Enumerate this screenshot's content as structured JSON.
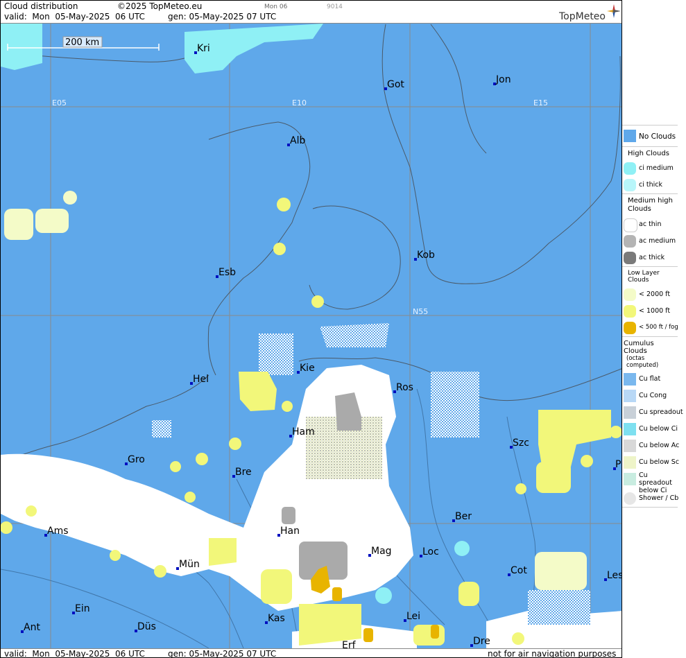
{
  "header": {
    "title": "Cloud distribution",
    "copyright": "©2025 TopMeteo.eu",
    "day_code": "Mon 06",
    "code": "9014",
    "valid": "valid:  Mon  05-May-2025  06 UTC",
    "gen": "gen: 05-May-2025 07 UTC",
    "brand": "TopMeteo"
  },
  "footer": {
    "valid": "valid:  Mon  05-May-2025  06 UTC",
    "gen": "gen: 05-May-2025 07 UTC",
    "disclaimer": "not for air navigation purposes"
  },
  "map": {
    "scale_label": "200 km",
    "grid_labels": {
      "e05": "E05",
      "e10": "E10",
      "e15": "E15",
      "n55": "N55"
    },
    "cities": {
      "kri": "Kri",
      "got": "Got",
      "jon": "Jon",
      "alb": "Alb",
      "kob": "Kob",
      "esb": "Esb",
      "kie": "Kie",
      "hel": "Hel",
      "ros": "Ros",
      "ham": "Ham",
      "szc": "Szc",
      "gro": "Gro",
      "bre": "Bre",
      "ber": "Ber",
      "ams": "Ams",
      "han": "Han",
      "mag": "Mag",
      "loc": "Loc",
      "mun": "Mün",
      "cot": "Cot",
      "les": "Les",
      "ein": "Ein",
      "kas": "Kas",
      "lei": "Lei",
      "ant": "Ant",
      "dus": "Düs",
      "dre": "Dre",
      "erf": "Erf",
      "p": "P"
    }
  },
  "legend": {
    "no_clouds": "No Clouds",
    "high_clouds": "High Clouds",
    "ci_medium": "ci medium",
    "ci_thick": "ci thick",
    "medium_high": "Medium high Clouds",
    "ac_thin": "ac thin",
    "ac_medium": "ac medium",
    "ac_thick": "ac thick",
    "low_layer": "Low Layer Clouds",
    "lt2000": "< 2000 ft",
    "lt1000": "< 1000 ft",
    "lt500": "< 500 ft / fog",
    "cumulus": "Cumulus Clouds",
    "cumulus_sub": "(octas computed)",
    "cu_flat": "Cu flat",
    "cu_cong": "Cu Cong",
    "cu_spreadout": "Cu spreadout",
    "cu_below_ci": "Cu below Ci",
    "cu_below_ac": "Cu below Ac",
    "cu_below_sc": "Cu below Sc",
    "cu_spreadout_below_ci": "Cu spreadout below Ci",
    "shower_cb": "Shower / Cb"
  },
  "colors": {
    "sea": "#5fa8ea",
    "ci": "#8ff0f5",
    "ac": "#b4b4b4",
    "low2000": "#f4fbc8",
    "low1000": "#f2f77a",
    "fog": "#e8b400",
    "white": "#ffffff"
  }
}
